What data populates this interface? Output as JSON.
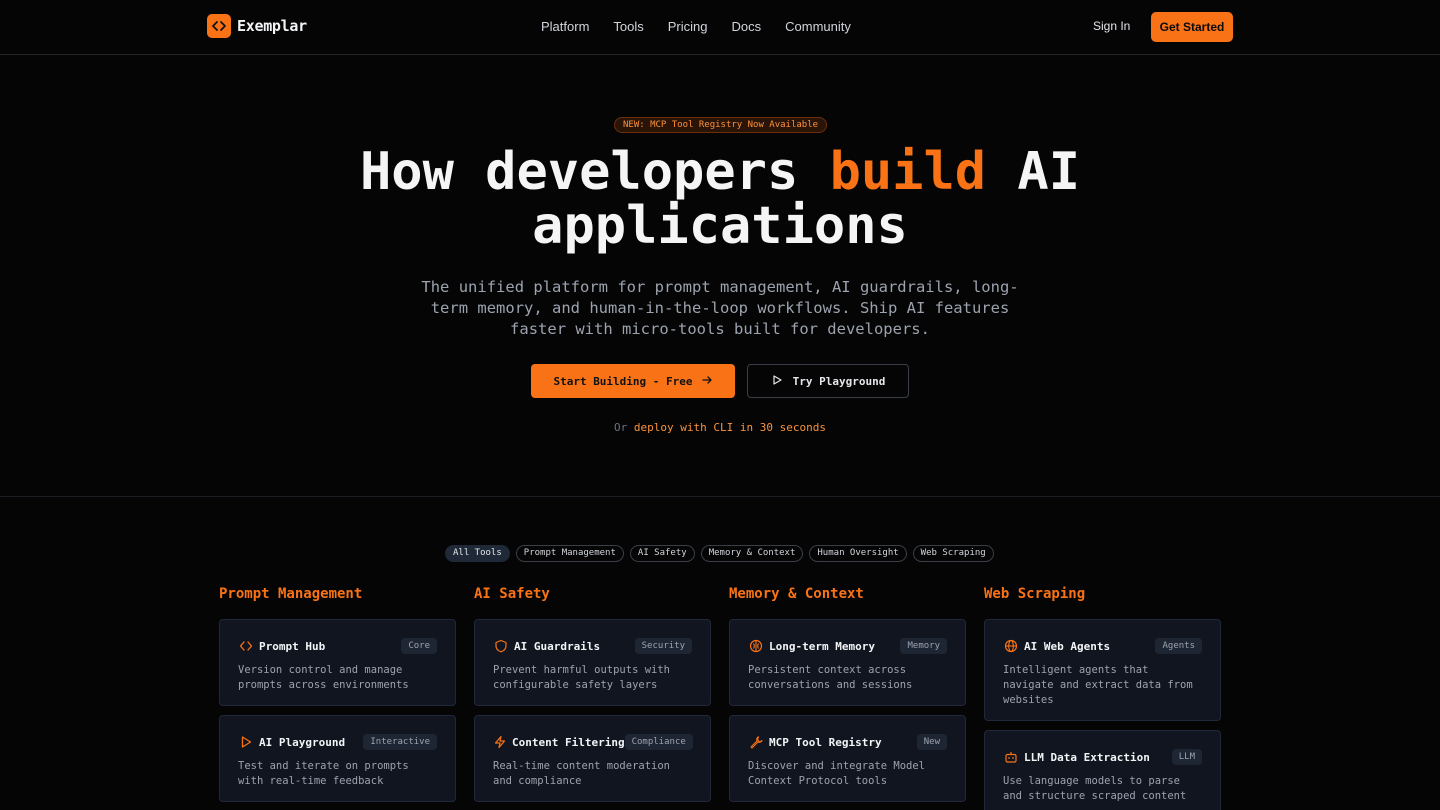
{
  "nav": {
    "brand": "Exemplar",
    "links": [
      "Platform",
      "Tools",
      "Pricing",
      "Docs",
      "Community"
    ],
    "sign_in": "Sign In",
    "get_started": "Get Started"
  },
  "hero": {
    "badge": "NEW: MCP Tool Registry Now Available",
    "headline_part1": "How developers ",
    "headline_accent": "build",
    "headline_part2": " AI",
    "headline_line2": "applications",
    "subtitle": "The unified platform for prompt management, AI guardrails, long-term memory, and human-in-the-loop workflows. Ship AI features faster with micro-tools built for developers.",
    "primary_cta": "Start Building - Free",
    "secondary_cta": "Try Playground",
    "cli_prefix": "Or",
    "cli_link": "deploy with CLI in 30 seconds"
  },
  "filters": [
    "All Tools",
    "Prompt Management",
    "AI Safety",
    "Memory & Context",
    "Human Oversight",
    "Web Scraping"
  ],
  "active_filter": "All Tools",
  "columns": [
    {
      "title": "Prompt Management",
      "cards": [
        {
          "icon": "code-icon",
          "title": "Prompt Hub",
          "tag": "Core",
          "desc": "Version control and manage prompts across environments"
        },
        {
          "icon": "play-icon",
          "title": "AI Playground",
          "tag": "Interactive",
          "desc": "Test and iterate on prompts with real-time feedback"
        }
      ]
    },
    {
      "title": "AI Safety",
      "cards": [
        {
          "icon": "shield-icon",
          "title": "AI Guardrails",
          "tag": "Security",
          "desc": "Prevent harmful outputs with configurable safety layers"
        },
        {
          "icon": "zap-icon",
          "title": "Content Filtering",
          "tag": "Compliance",
          "desc": "Real-time content moderation and compliance"
        }
      ]
    },
    {
      "title": "Memory & Context",
      "cards": [
        {
          "icon": "brain-icon",
          "title": "Long-term Memory",
          "tag": "Memory",
          "desc": "Persistent context across conversations and sessions"
        },
        {
          "icon": "wrench-icon",
          "title": "MCP Tool Registry",
          "tag": "New",
          "desc": "Discover and integrate Model Context Protocol tools"
        }
      ]
    },
    {
      "title": "Web Scraping",
      "cards": [
        {
          "icon": "globe-icon",
          "title": "AI Web Agents",
          "tag": "Agents",
          "desc": "Intelligent agents that navigate and extract data from websites"
        },
        {
          "icon": "bot-icon",
          "title": "LLM Data Extraction",
          "tag": "LLM",
          "desc": "Use language models to parse and structure scraped content"
        }
      ]
    }
  ],
  "colors": {
    "accent": "#f97316",
    "background": "#050505",
    "card": "#101520"
  }
}
